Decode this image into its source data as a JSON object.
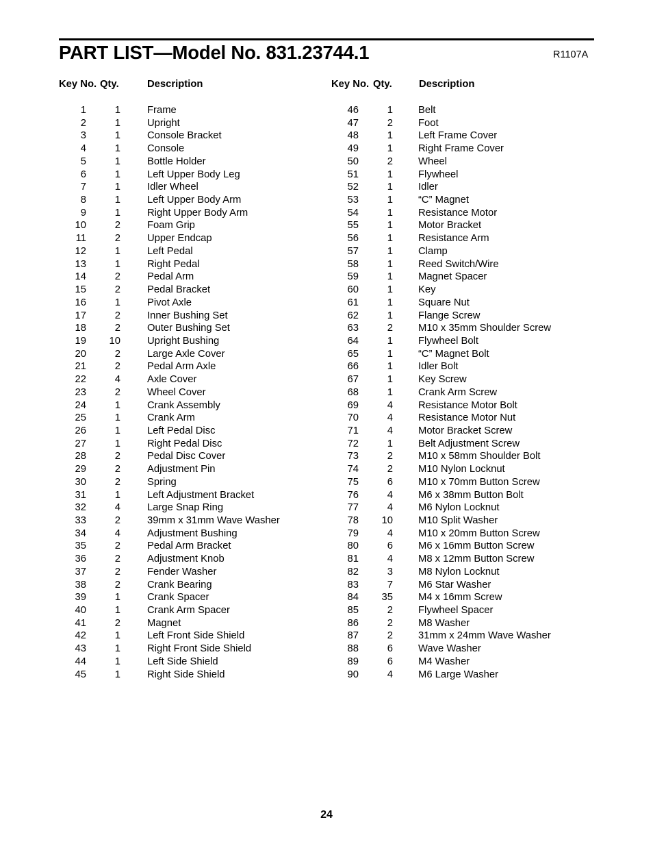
{
  "document": {
    "title": "PART LIST—Model No. 831.23744.1",
    "revision_code": "R1107A",
    "page_number": "24"
  },
  "table_headers": {
    "key_no": "Key No.",
    "qty": "Qty.",
    "description": "Description"
  },
  "parts_left": [
    {
      "key": "1",
      "qty": "1",
      "desc": "Frame"
    },
    {
      "key": "2",
      "qty": "1",
      "desc": "Upright"
    },
    {
      "key": "3",
      "qty": "1",
      "desc": "Console Bracket"
    },
    {
      "key": "4",
      "qty": "1",
      "desc": "Console"
    },
    {
      "key": "5",
      "qty": "1",
      "desc": "Bottle Holder"
    },
    {
      "key": "6",
      "qty": "1",
      "desc": "Left Upper Body Leg"
    },
    {
      "key": "7",
      "qty": "1",
      "desc": "Idler Wheel"
    },
    {
      "key": "8",
      "qty": "1",
      "desc": "Left Upper Body Arm"
    },
    {
      "key": "9",
      "qty": "1",
      "desc": "Right Upper Body Arm"
    },
    {
      "key": "10",
      "qty": "2",
      "desc": "Foam Grip"
    },
    {
      "key": "11",
      "qty": "2",
      "desc": "Upper Endcap"
    },
    {
      "key": "12",
      "qty": "1",
      "desc": "Left Pedal"
    },
    {
      "key": "13",
      "qty": "1",
      "desc": "Right Pedal"
    },
    {
      "key": "14",
      "qty": "2",
      "desc": "Pedal Arm"
    },
    {
      "key": "15",
      "qty": "2",
      "desc": "Pedal Bracket"
    },
    {
      "key": "16",
      "qty": "1",
      "desc": "Pivot Axle"
    },
    {
      "key": "17",
      "qty": "2",
      "desc": "Inner Bushing Set"
    },
    {
      "key": "18",
      "qty": "2",
      "desc": "Outer Bushing Set"
    },
    {
      "key": "19",
      "qty": "10",
      "desc": "Upright Bushing"
    },
    {
      "key": "20",
      "qty": "2",
      "desc": "Large Axle Cover"
    },
    {
      "key": "21",
      "qty": "2",
      "desc": "Pedal Arm Axle"
    },
    {
      "key": "22",
      "qty": "4",
      "desc": "Axle Cover"
    },
    {
      "key": "23",
      "qty": "2",
      "desc": "Wheel Cover"
    },
    {
      "key": "24",
      "qty": "1",
      "desc": "Crank Assembly"
    },
    {
      "key": "25",
      "qty": "1",
      "desc": "Crank Arm"
    },
    {
      "key": "26",
      "qty": "1",
      "desc": "Left Pedal Disc"
    },
    {
      "key": "27",
      "qty": "1",
      "desc": "Right Pedal Disc"
    },
    {
      "key": "28",
      "qty": "2",
      "desc": "Pedal Disc Cover"
    },
    {
      "key": "29",
      "qty": "2",
      "desc": "Adjustment Pin"
    },
    {
      "key": "30",
      "qty": "2",
      "desc": "Spring"
    },
    {
      "key": "31",
      "qty": "1",
      "desc": "Left Adjustment Bracket"
    },
    {
      "key": "32",
      "qty": "4",
      "desc": "Large Snap Ring"
    },
    {
      "key": "33",
      "qty": "2",
      "desc": "39mm x 31mm Wave Washer"
    },
    {
      "key": "34",
      "qty": "4",
      "desc": "Adjustment Bushing"
    },
    {
      "key": "35",
      "qty": "2",
      "desc": "Pedal Arm Bracket"
    },
    {
      "key": "36",
      "qty": "2",
      "desc": "Adjustment Knob"
    },
    {
      "key": "37",
      "qty": "2",
      "desc": "Fender Washer"
    },
    {
      "key": "38",
      "qty": "2",
      "desc": "Crank Bearing"
    },
    {
      "key": "39",
      "qty": "1",
      "desc": "Crank Spacer"
    },
    {
      "key": "40",
      "qty": "1",
      "desc": "Crank Arm Spacer"
    },
    {
      "key": "41",
      "qty": "2",
      "desc": "Magnet"
    },
    {
      "key": "42",
      "qty": "1",
      "desc": "Left Front Side Shield"
    },
    {
      "key": "43",
      "qty": "1",
      "desc": "Right Front Side Shield"
    },
    {
      "key": "44",
      "qty": "1",
      "desc": "Left Side Shield"
    },
    {
      "key": "45",
      "qty": "1",
      "desc": "Right Side Shield"
    }
  ],
  "parts_right": [
    {
      "key": "46",
      "qty": "1",
      "desc": "Belt"
    },
    {
      "key": "47",
      "qty": "2",
      "desc": "Foot"
    },
    {
      "key": "48",
      "qty": "1",
      "desc": "Left Frame Cover"
    },
    {
      "key": "49",
      "qty": "1",
      "desc": "Right Frame Cover"
    },
    {
      "key": "50",
      "qty": "2",
      "desc": "Wheel"
    },
    {
      "key": "51",
      "qty": "1",
      "desc": "Flywheel"
    },
    {
      "key": "52",
      "qty": "1",
      "desc": "Idler"
    },
    {
      "key": "53",
      "qty": "1",
      "desc": "“C” Magnet"
    },
    {
      "key": "54",
      "qty": "1",
      "desc": "Resistance Motor"
    },
    {
      "key": "55",
      "qty": "1",
      "desc": "Motor Bracket"
    },
    {
      "key": "56",
      "qty": "1",
      "desc": "Resistance Arm"
    },
    {
      "key": "57",
      "qty": "1",
      "desc": "Clamp"
    },
    {
      "key": "58",
      "qty": "1",
      "desc": "Reed Switch/Wire"
    },
    {
      "key": "59",
      "qty": "1",
      "desc": "Magnet Spacer"
    },
    {
      "key": "60",
      "qty": "1",
      "desc": "Key"
    },
    {
      "key": "61",
      "qty": "1",
      "desc": "Square Nut"
    },
    {
      "key": "62",
      "qty": "1",
      "desc": "Flange Screw"
    },
    {
      "key": "63",
      "qty": "2",
      "desc": "M10 x 35mm Shoulder Screw"
    },
    {
      "key": "64",
      "qty": "1",
      "desc": "Flywheel Bolt"
    },
    {
      "key": "65",
      "qty": "1",
      "desc": "“C” Magnet Bolt"
    },
    {
      "key": "66",
      "qty": "1",
      "desc": "Idler Bolt"
    },
    {
      "key": "67",
      "qty": "1",
      "desc": "Key Screw"
    },
    {
      "key": "68",
      "qty": "1",
      "desc": "Crank Arm Screw"
    },
    {
      "key": "69",
      "qty": "4",
      "desc": "Resistance Motor Bolt"
    },
    {
      "key": "70",
      "qty": "4",
      "desc": "Resistance Motor Nut"
    },
    {
      "key": "71",
      "qty": "4",
      "desc": "Motor Bracket Screw"
    },
    {
      "key": "72",
      "qty": "1",
      "desc": "Belt Adjustment Screw"
    },
    {
      "key": "73",
      "qty": "2",
      "desc": "M10 x 58mm Shoulder Bolt"
    },
    {
      "key": "74",
      "qty": "2",
      "desc": "M10 Nylon Locknut"
    },
    {
      "key": "75",
      "qty": "6",
      "desc": "M10 x 70mm Button Screw"
    },
    {
      "key": "76",
      "qty": "4",
      "desc": "M6 x 38mm Button Bolt"
    },
    {
      "key": "77",
      "qty": "4",
      "desc": "M6 Nylon Locknut"
    },
    {
      "key": "78",
      "qty": "10",
      "desc": "M10 Split Washer"
    },
    {
      "key": "79",
      "qty": "4",
      "desc": "M10 x 20mm Button Screw"
    },
    {
      "key": "80",
      "qty": "6",
      "desc": "M6 x 16mm Button Screw"
    },
    {
      "key": "81",
      "qty": "4",
      "desc": "M8 x 12mm Button Screw"
    },
    {
      "key": "82",
      "qty": "3",
      "desc": "M8 Nylon Locknut"
    },
    {
      "key": "83",
      "qty": "7",
      "desc": "M6 Star Washer"
    },
    {
      "key": "84",
      "qty": "35",
      "desc": "M4 x 16mm Screw"
    },
    {
      "key": "85",
      "qty": "2",
      "desc": "Flywheel Spacer"
    },
    {
      "key": "86",
      "qty": "2",
      "desc": "M8 Washer"
    },
    {
      "key": "87",
      "qty": "2",
      "desc": "31mm x 24mm Wave Washer"
    },
    {
      "key": "88",
      "qty": "6",
      "desc": "Wave Washer"
    },
    {
      "key": "89",
      "qty": "6",
      "desc": "M4 Washer"
    },
    {
      "key": "90",
      "qty": "4",
      "desc": "M6 Large Washer"
    }
  ]
}
